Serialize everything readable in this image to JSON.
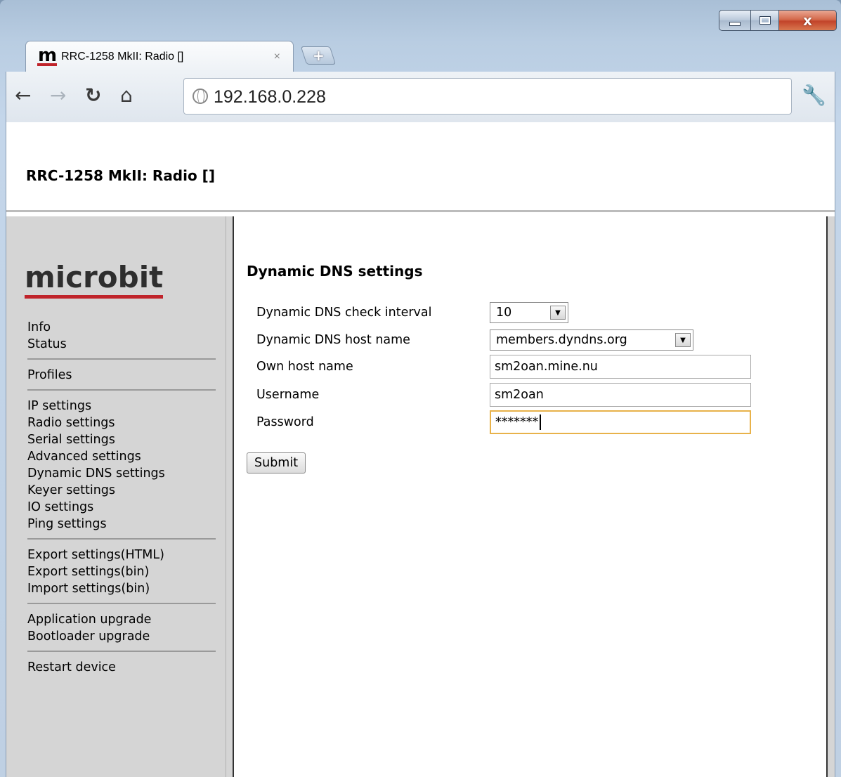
{
  "browser": {
    "tab_title": "RRC-1258 MkII: Radio []",
    "tab_favicon": "m",
    "tab_close": "×",
    "new_tab": "+",
    "url": "192.168.0.228",
    "nav_icons": {
      "back": "back-arrow-icon",
      "forward": "forward-arrow-icon",
      "reload": "reload-icon",
      "home": "home-icon",
      "menu": "wrench-icon"
    },
    "window_controls": {
      "minimize": "minimize-icon",
      "maximize": "maximize-icon",
      "close": "x"
    }
  },
  "header": {
    "title": "RRC-1258 MkII: Radio []"
  },
  "sidebar": {
    "logo": "microbit",
    "groups": [
      [
        "Info",
        "Status"
      ],
      [
        "Profiles"
      ],
      [
        "IP settings",
        "Radio settings",
        "Serial settings",
        "Advanced settings",
        "Dynamic DNS settings",
        "Keyer settings",
        "IO settings",
        "Ping settings"
      ],
      [
        "Export settings(HTML)",
        "Export settings(bin)",
        "Import settings(bin)"
      ],
      [
        "Application upgrade",
        "Bootloader upgrade"
      ],
      [
        "Restart device"
      ]
    ]
  },
  "main": {
    "section_title": "Dynamic DNS settings",
    "fields": {
      "check_interval": {
        "label": "Dynamic DNS check interval",
        "value": "10"
      },
      "host_name": {
        "label": "Dynamic DNS host name",
        "value": "members.dyndns.org"
      },
      "own_host": {
        "label": "Own host name",
        "value": "sm2oan.mine.nu"
      },
      "username": {
        "label": "Username",
        "value": "sm2oan"
      },
      "password": {
        "label": "Password",
        "value": "*******"
      }
    },
    "submit_label": "Submit"
  },
  "colors": {
    "brand_red": "#c0242b",
    "focus_border": "#e8b24a",
    "sidebar_bg": "#d5d5d5"
  }
}
